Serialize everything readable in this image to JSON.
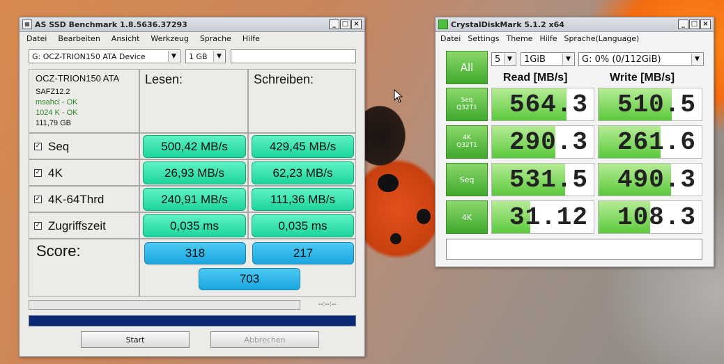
{
  "asssd": {
    "title": "AS SSD Benchmark 1.8.5636.37293",
    "menu": [
      "Datei",
      "Bearbeiten",
      "Ansicht",
      "Werkzeug",
      "Sprache",
      "Hilfe"
    ],
    "drive_select": "G: OCZ-TRION150 ATA Device",
    "size_select": "1 GB",
    "device_name": "OCZ-TRION150 ATA",
    "firmware": "SAFZ12.2",
    "msahci": "msahci - OK",
    "alignment": "1024 K - OK",
    "capacity": "111,79 GB",
    "read_header": "Lesen:",
    "write_header": "Schreiben:",
    "rows": [
      {
        "label": "Seq",
        "read": "500,42 MB/s",
        "write": "429,45 MB/s"
      },
      {
        "label": "4K",
        "read": "26,93 MB/s",
        "write": "62,23 MB/s"
      },
      {
        "label": "4K-64Thrd",
        "read": "240,91 MB/s",
        "write": "111,36 MB/s"
      },
      {
        "label": "Zugriffszeit",
        "read": "0,035 ms",
        "write": "0,035 ms"
      }
    ],
    "score_label": "Score:",
    "score_read": "318",
    "score_write": "217",
    "score_total": "703",
    "time": "--:--:--",
    "start": "Start",
    "abort": "Abbrechen",
    "controls": {
      "min": "_",
      "max": "□",
      "close": "×"
    }
  },
  "cdm": {
    "title": "CrystalDiskMark 5.1.2 x64",
    "menu": [
      "Datei",
      "Settings",
      "Theme",
      "Hilfe",
      "Sprache(Language)"
    ],
    "all": "All",
    "count": "5",
    "size": "1GiB",
    "drive": "G: 0% (0/112GiB)",
    "read_header": "Read [MB/s]",
    "write_header": "Write [MB/s]",
    "rows": [
      {
        "line1": "Seq",
        "line2": "Q32T1",
        "read": "564.3",
        "write": "510.5",
        "read_frac": 0.73,
        "write_frac": 0.71
      },
      {
        "line1": "4K",
        "line2": "Q32T1",
        "read": "290.3",
        "write": "261.6",
        "read_frac": 0.62,
        "write_frac": 0.6
      },
      {
        "line1": "Seq",
        "line2": "",
        "read": "531.5",
        "write": "490.3",
        "read_frac": 0.72,
        "write_frac": 0.7
      },
      {
        "line1": "4K",
        "line2": "",
        "read": "31.12",
        "write": "108.3",
        "read_frac": 0.38,
        "write_frac": 0.5
      }
    ],
    "controls": {
      "min": "_",
      "max": "□",
      "close": "×"
    }
  }
}
